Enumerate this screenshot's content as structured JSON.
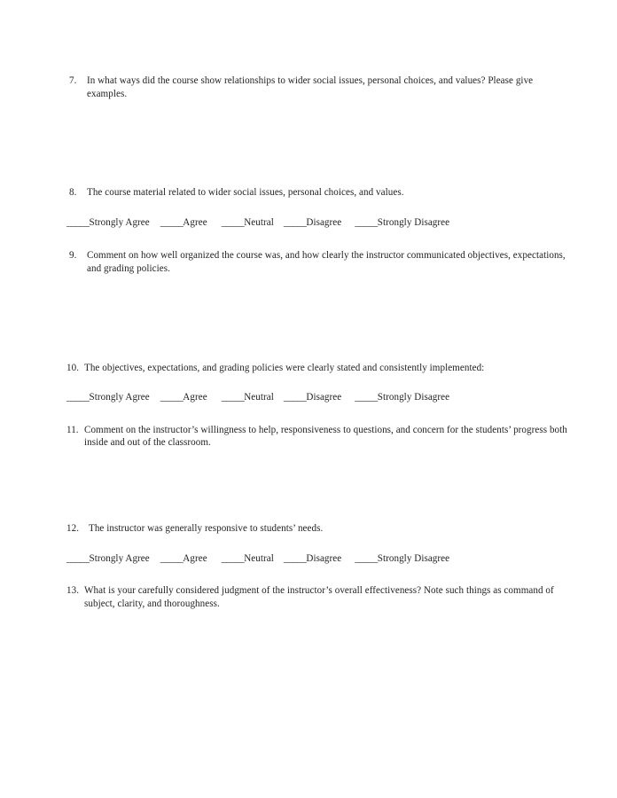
{
  "document": {
    "type": "course-evaluation-form",
    "page_background": "#ffffff",
    "text_color": "#232323"
  },
  "questions": [
    {
      "number": "7.",
      "text": "In what ways did the course show relationships to wider social issues, personal choices, and values?  Please give examples.",
      "style": "open-ended"
    },
    {
      "number": "8.",
      "text": "The course material related to wider social issues, personal choices, and values.",
      "style": "likert"
    },
    {
      "number": "9.",
      "text": "Comment on how well organized the course was, and how clearly the instructor communicated objectives, expectations, and grading policies.",
      "style": "open-ended"
    },
    {
      "number": "10.",
      "text": "The objectives, expectations, and grading policies were clearly stated and consistently implemented:",
      "style": "likert"
    },
    {
      "number": "11.",
      "text": "Comment on the instructor’s willingness to help, responsiveness to questions, and concern for the students’ progress both inside and out of the classroom.",
      "style": "open-ended"
    },
    {
      "number": "12.",
      "text": "The instructor was generally responsive to students’ needs.",
      "style": "likert"
    },
    {
      "number": "13.",
      "text": "What is your carefully considered judgment of the instructor’s overall effectiveness?  Note such things as command of subject, clarity, and thoroughness.",
      "style": "open-ended"
    }
  ],
  "scale": {
    "blank": "_____",
    "options": [
      "Strongly Agree",
      "Agree",
      "Neutral",
      "Disagree",
      "Strongly Disagree"
    ]
  }
}
